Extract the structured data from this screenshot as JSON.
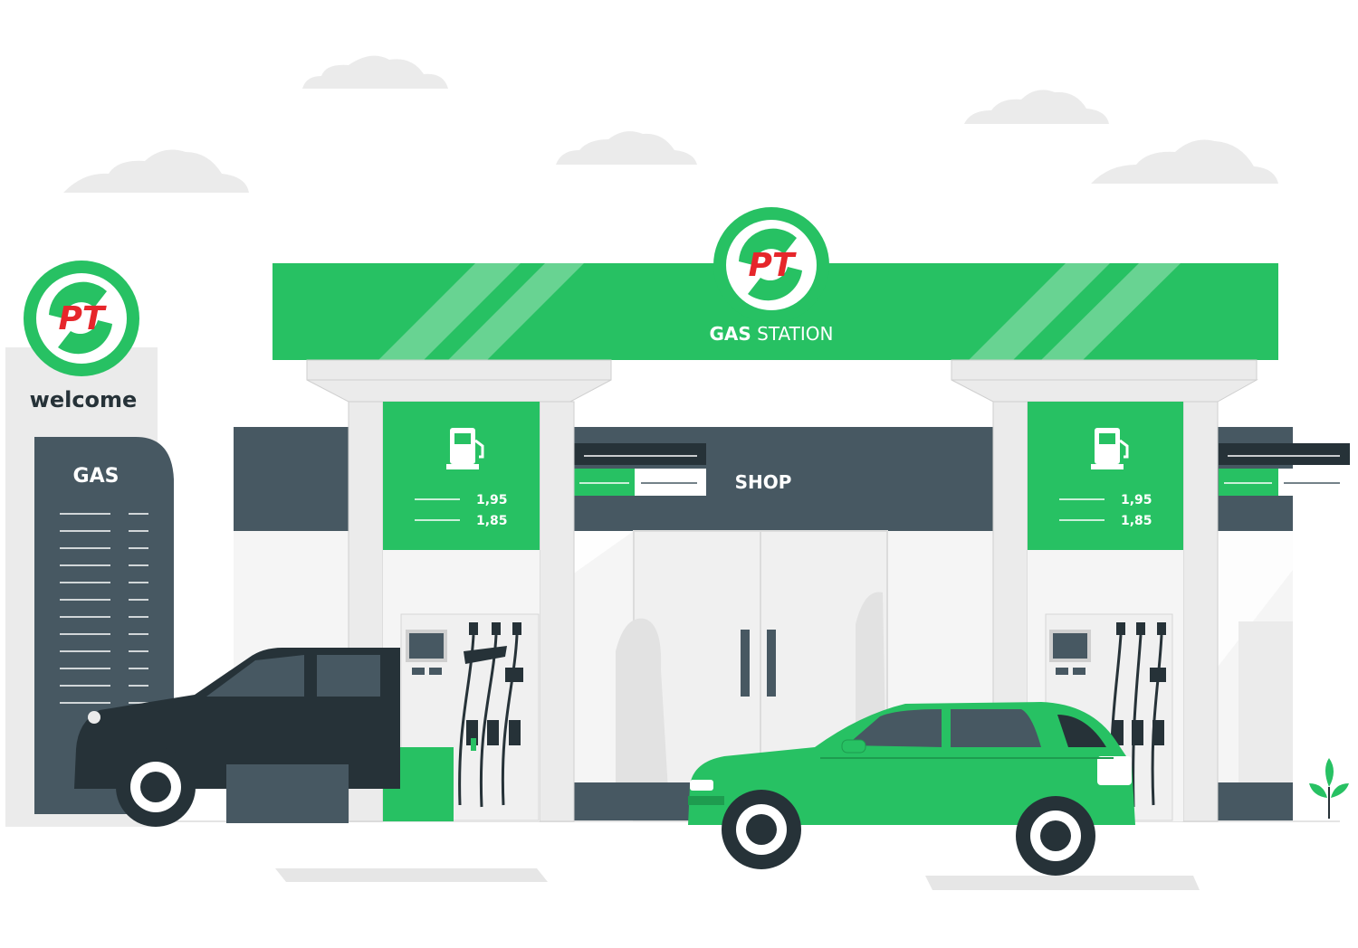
{
  "brand": {
    "logo_text": "PT",
    "canopy_word_bold": "GAS",
    "canopy_word_rest": " STATION",
    "colors": {
      "green": "#27c163",
      "red": "#e6262b",
      "dark": "#475862",
      "charcoal": "#263238",
      "light": "#ebebeb"
    }
  },
  "totem": {
    "welcome": "welcome",
    "gas": "GAS"
  },
  "shop": {
    "label": "SHOP"
  },
  "pumps": [
    {
      "icon": "fuel-pump-icon",
      "prices": [
        "1,95",
        "1,85"
      ]
    },
    {
      "icon": "fuel-pump-icon",
      "prices": [
        "1,95",
        "1,85"
      ]
    }
  ]
}
